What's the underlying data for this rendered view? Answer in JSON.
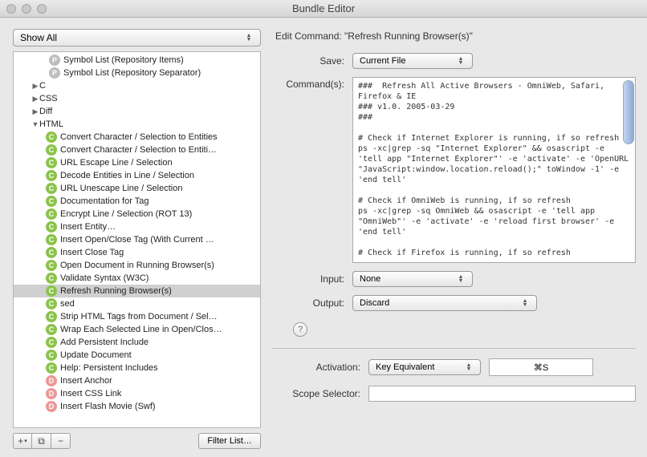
{
  "window": {
    "title": "Bundle Editor"
  },
  "sidebar": {
    "filter": "Show All",
    "items": [
      {
        "indent": 3,
        "badge": "P",
        "label": "Symbol List (Repository Items)"
      },
      {
        "indent": 3,
        "badge": "P",
        "label": "Symbol List (Repository Separator)"
      },
      {
        "indent": 1,
        "disclosure": "closed",
        "label": "C"
      },
      {
        "indent": 1,
        "disclosure": "closed",
        "label": "CSS"
      },
      {
        "indent": 1,
        "disclosure": "closed",
        "label": "Diff"
      },
      {
        "indent": 1,
        "disclosure": "open",
        "label": "HTML"
      },
      {
        "indent": 2,
        "badge": "C",
        "label": "Convert Character / Selection to Entities"
      },
      {
        "indent": 2,
        "badge": "C",
        "label": "Convert Character / Selection to Entiti…"
      },
      {
        "indent": 2,
        "badge": "C",
        "label": "URL Escape Line / Selection"
      },
      {
        "indent": 2,
        "badge": "C",
        "label": "Decode Entities in Line / Selection"
      },
      {
        "indent": 2,
        "badge": "C",
        "label": "URL Unescape Line / Selection"
      },
      {
        "indent": 2,
        "badge": "C",
        "label": "Documentation for Tag"
      },
      {
        "indent": 2,
        "badge": "C",
        "label": "Encrypt Line / Selection (ROT 13)"
      },
      {
        "indent": 2,
        "badge": "C",
        "label": "Insert Entity…"
      },
      {
        "indent": 2,
        "badge": "C",
        "label": "Insert Open/Close Tag (With Current …"
      },
      {
        "indent": 2,
        "badge": "C",
        "label": "Insert Close Tag"
      },
      {
        "indent": 2,
        "badge": "C",
        "label": "Open Document in Running Browser(s)"
      },
      {
        "indent": 2,
        "badge": "C",
        "label": "Validate Syntax (W3C)"
      },
      {
        "indent": 2,
        "badge": "C",
        "label": "Refresh Running Browser(s)",
        "selected": true
      },
      {
        "indent": 2,
        "badge": "C",
        "label": "sed"
      },
      {
        "indent": 2,
        "badge": "C",
        "label": "Strip HTML Tags from Document / Sel…"
      },
      {
        "indent": 2,
        "badge": "C",
        "label": "Wrap Each Selected Line in Open/Clos…"
      },
      {
        "indent": 2,
        "badge": "C",
        "label": "Add Persistent Include"
      },
      {
        "indent": 2,
        "badge": "C",
        "label": "Update Document"
      },
      {
        "indent": 2,
        "badge": "C",
        "label": "Help: Persistent Includes"
      },
      {
        "indent": 2,
        "badge": "D",
        "label": "Insert Anchor"
      },
      {
        "indent": 2,
        "badge": "D",
        "label": "Insert CSS Link"
      },
      {
        "indent": 2,
        "badge": "D",
        "label": "Insert Flash Movie (Swf)"
      }
    ],
    "filter_button": "Filter List…"
  },
  "editor": {
    "heading": "Edit Command: \"Refresh Running Browser(s)\"",
    "save_label": "Save:",
    "save_value": "Current File",
    "commands_label": "Command(s):",
    "commands_text": "###  Refresh All Active Browsers - OmniWeb, Safari, Firefox & IE\n### v1.0. 2005-03-29\n###\n\n# Check if Internet Explorer is running, if so refresh\nps -xc|grep -sq \"Internet Explorer\" && osascript -e 'tell app \"Internet Explorer\"' -e 'activate' -e 'OpenURL \"JavaScript:window.location.reload();\" toWindow -1' -e 'end tell'\n\n# Check if OmniWeb is running, if so refresh\nps -xc|grep -sq OmniWeb && osascript -e 'tell app \"OmniWeb\"' -e 'activate' -e 'reload first browser' -e 'end tell'\n\n# Check if Firefox is running, if so refresh",
    "input_label": "Input:",
    "input_value": "None",
    "output_label": "Output:",
    "output_value": "Discard",
    "activation_label": "Activation:",
    "activation_value": "Key Equivalent",
    "key_equiv": "⌘S",
    "scope_label": "Scope Selector:",
    "scope_value": ""
  }
}
